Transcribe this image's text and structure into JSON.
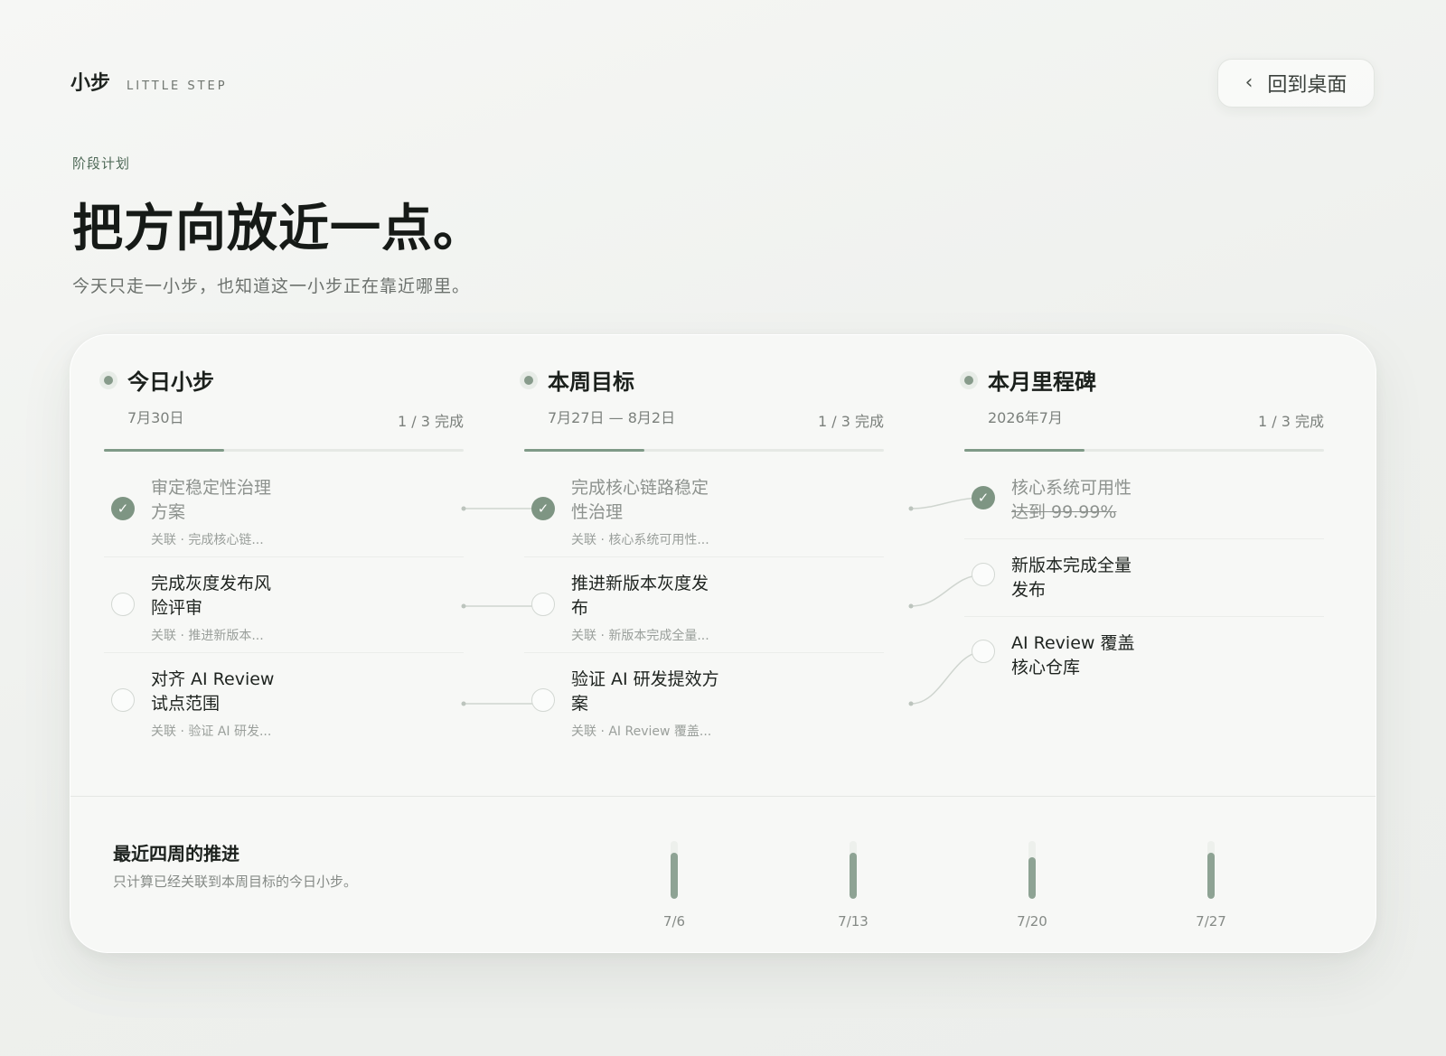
{
  "brand": {
    "name": "小步",
    "subtitle": "LITTLE STEP"
  },
  "back_button": {
    "icon": "chevron-left-icon",
    "label": "回到桌面"
  },
  "header": {
    "eyebrow": "阶段计划",
    "headline": "把方向放近一点。",
    "subline": "今天只走一小步，也知道这一小步正在靠近哪里。"
  },
  "columns": [
    {
      "title": "今日小步",
      "date": "7月30日",
      "count": "1 / 3 完成",
      "progress": 0.3333,
      "tasks": [
        {
          "line1": "审定稳定性治理",
          "line2": "方案",
          "link": "关联 · 完成核心链...",
          "done": true
        },
        {
          "line1": "完成灰度发布风",
          "line2": "险评审",
          "link": "关联 · 推进新版本...",
          "done": false
        },
        {
          "line1": "对齐 AI Review",
          "line2": "试点范围",
          "link": "关联 · 验证 AI 研发...",
          "done": false
        }
      ]
    },
    {
      "title": "本周目标",
      "date": "7月27日 — 8月2日",
      "count": "1 / 3 完成",
      "progress": 0.3333,
      "tasks": [
        {
          "line1": "完成核心链路稳定",
          "line2": "性治理",
          "link": "关联 · 核心系统可用性...",
          "done": true
        },
        {
          "line1": "推进新版本灰度发",
          "line2": "布",
          "link": "关联 · 新版本完成全量...",
          "done": false
        },
        {
          "line1": "验证 AI 研发提效方",
          "line2": "案",
          "link": "关联 · AI Review 覆盖...",
          "done": false
        }
      ]
    },
    {
      "title": "本月里程碑",
      "date": "2026年7月",
      "count": "1 / 3 完成",
      "progress": 0.3333,
      "tasks": [
        {
          "line1": "核心系统可用性",
          "line2": "达到 99.99%",
          "done": true
        },
        {
          "line1": "新版本完成全量",
          "line2": "发布",
          "done": false
        },
        {
          "line1": "AI Review 覆盖",
          "line2": "核心仓库",
          "done": false
        }
      ]
    }
  ],
  "recent": {
    "title": "最近四周的推进",
    "subtitle": "只计算已经关联到本周目标的今日小步。",
    "weeks": [
      {
        "label": "7/6",
        "value": 0.8
      },
      {
        "label": "7/13",
        "value": 0.8
      },
      {
        "label": "7/20",
        "value": 0.72
      },
      {
        "label": "7/27",
        "value": 0.8
      }
    ]
  },
  "colors": {
    "accent": "#7f9a87",
    "done": "#7e9583",
    "background": "#f1f3f0"
  }
}
